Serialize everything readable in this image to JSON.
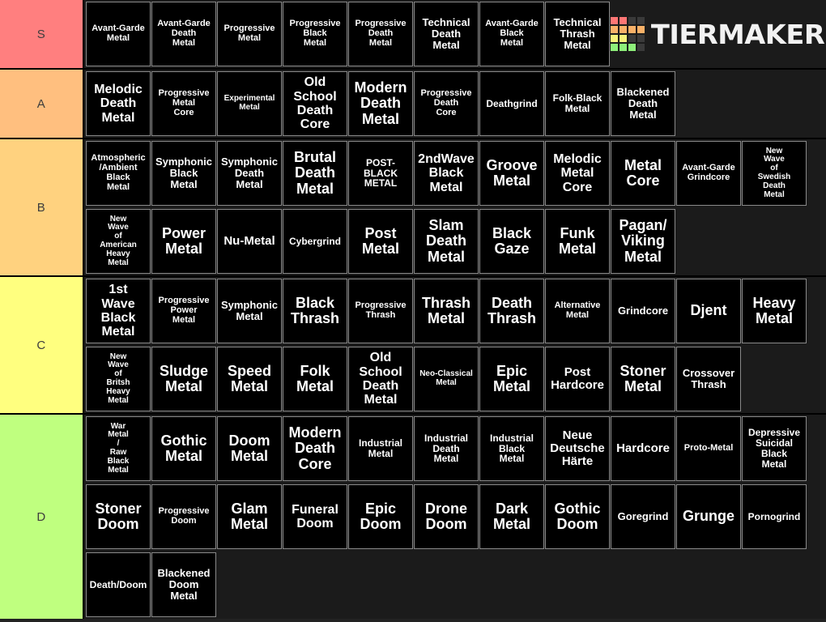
{
  "brand": {
    "name": "TIERMAKER",
    "logo_icon": "tiermaker-grid-logo",
    "logo_grid_colors": [
      "#ff7675",
      "#ff7675",
      "#3a3a3a",
      "#3a3a3a",
      "#f9b168",
      "#f9b168",
      "#f9b168",
      "#f9b168",
      "#f7f279",
      "#f7f279",
      "#3a3a3a",
      "#3a3a3a",
      "#8ef07a",
      "#8ef07a",
      "#8ef07a",
      "#3a3a3a"
    ]
  },
  "colors": {
    "background": "#222222",
    "row_background": "#1b1b1b",
    "item_background": "#000000",
    "item_border": "#8a8a8a",
    "label_text": "#3d3d3d",
    "item_text": "#ffffff"
  },
  "tiers": [
    {
      "label": "S",
      "color": "#ff7f7f",
      "rows": [
        [
          "Avant-Garde Metal",
          "Avant-Garde Death Metal",
          "Progressive Metal",
          "Progressive Black Metal",
          "Progressive Death Metal",
          "Technical Death Metal",
          "Avant-Garde Black Metal",
          "Technical Thrash Metal"
        ]
      ]
    },
    {
      "label": "A",
      "color": "#ffbf7f",
      "rows": [
        [
          "Melodic Death Metal",
          "Progressive Metal Core",
          "Experimental Metal",
          "Old School Death Core",
          "Modern Death Metal",
          "Progressive Death Core",
          "Deathgrind",
          "Folk-Black Metal",
          "Blackened Death Metal"
        ]
      ]
    },
    {
      "label": "B",
      "color": "#ffd27f",
      "rows": [
        [
          "Atmospheric /Ambient Black Metal",
          "Symphonic Black Metal",
          "Symphonic Death Metal",
          "Brutal Death Metal",
          "POST-BLACK METAL",
          "2ndWave Black Metal",
          "Groove Metal",
          "Melodic Metal Core",
          "Metal Core",
          "Avant-Garde Grindcore",
          "New Wave of Swedish Death Metal"
        ],
        [
          "New Wave of American Heavy Metal",
          "Power Metal",
          "Nu-Metal",
          "Cybergrind",
          "Post Metal",
          "Slam Death Metal",
          "Black Gaze",
          "Funk Metal",
          "Pagan/ Viking Metal"
        ]
      ]
    },
    {
      "label": "C",
      "color": "#ffff7f",
      "rows": [
        [
          "1st Wave Black Metal",
          "Progressive Power Metal",
          "Symphonic Metal",
          "Black Thrash",
          "Progressive Thrash",
          "Thrash Metal",
          "Death Thrash",
          "Alternative Metal",
          "Grindcore",
          "Djent",
          "Heavy Metal"
        ],
        [
          "New Wave of Britsh Heavy Metal",
          "Sludge Metal",
          "Speed Metal",
          "Folk Metal",
          "Old School Death Metal",
          "Neo-Classical Metal",
          "Epic Metal",
          "Post Hardcore",
          "Stoner Metal",
          "Crossover Thrash"
        ]
      ]
    },
    {
      "label": "D",
      "color": "#bfff7f",
      "rows": [
        [
          "War Metal / Raw Black Metal",
          "Gothic Metal",
          "Doom Metal",
          "Modern Death Core",
          "Industrial Metal",
          "Industrial Death Metal",
          "Industrial Black Metal",
          "Neue Deutsche Härte",
          "Hardcore",
          "Proto-Metal",
          "Depressive Suicidal Black Metal"
        ],
        [
          "Stoner Doom",
          "Progressive Doom",
          "Glam Metal",
          "Funeral Doom",
          "Epic Doom",
          "Drone Doom",
          "Dark Metal",
          "Gothic Doom",
          "Goregrind",
          "Grunge",
          "Pornogrind"
        ],
        [
          "Death/Doom",
          "Blackened Doom Metal"
        ]
      ]
    }
  ]
}
